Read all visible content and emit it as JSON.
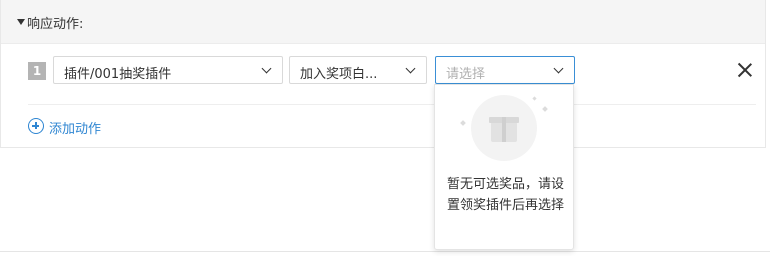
{
  "section": {
    "title": "响应动作:"
  },
  "action_row": {
    "index": "1",
    "plugin_select": {
      "value": "插件/001抽奖插件"
    },
    "action_select": {
      "value": "加入奖项白..."
    },
    "prize_select": {
      "placeholder": "请选择"
    }
  },
  "add_action": {
    "label": "添加动作"
  },
  "dropdown": {
    "empty_text": "暂无可选奖品，请设置领奖插件后再选择"
  },
  "colors": {
    "accent": "#2f86d2",
    "focus_border": "#3a8fd6",
    "header_bg": "#f5f5f5"
  },
  "icons": {
    "toggle": "caret-down-icon",
    "chevron": "chevron-down-icon",
    "close": "close-icon",
    "add": "plus-circle-icon",
    "empty": "gift-box-icon"
  }
}
